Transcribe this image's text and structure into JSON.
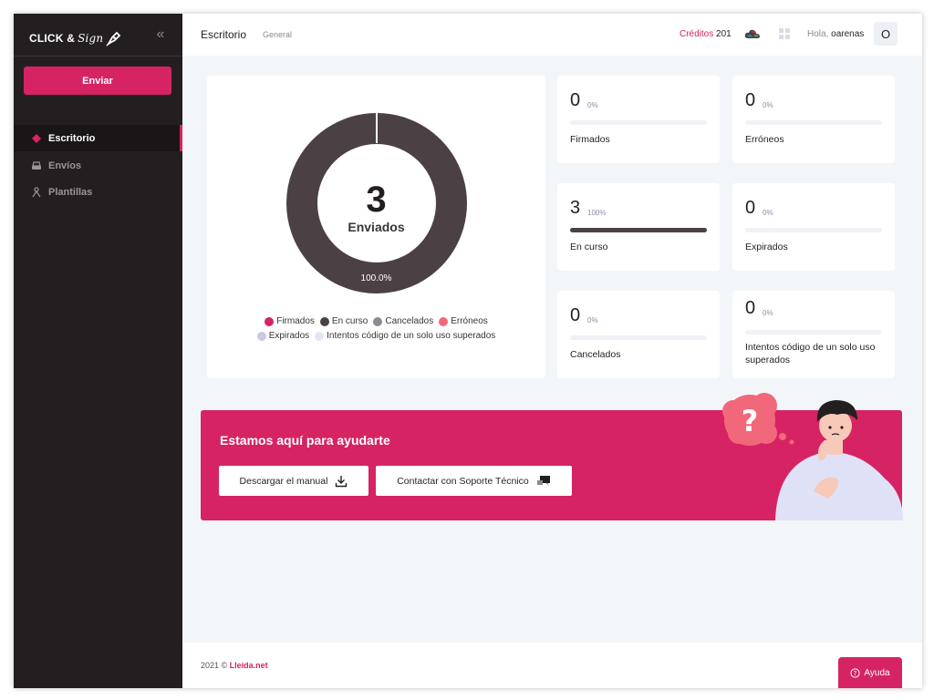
{
  "brand": {
    "name": "CLICK &",
    "script": "Sign"
  },
  "sidebar": {
    "send_label": "Enviar",
    "items": [
      {
        "label": "Escritorio",
        "icon": "diamond-icon",
        "active": true
      },
      {
        "label": "Envíos",
        "icon": "inbox-tray-icon",
        "active": false
      },
      {
        "label": "Plantillas",
        "icon": "template-person-icon",
        "active": false
      }
    ]
  },
  "topbar": {
    "title": "Escritorio",
    "crumb": "General",
    "credits_label": "Créditos",
    "credits_value": "201",
    "greeting": "Hola,",
    "username": "oarenas",
    "avatar_initial": "O"
  },
  "donut": {
    "center_value": "3",
    "center_label": "Enviados",
    "segment_label": "100.0%",
    "fraction": 1.0,
    "colors": {
      "ring": "#4b4145"
    }
  },
  "legend": [
    {
      "label": "Firmados",
      "color": "#d62364"
    },
    {
      "label": "En curso",
      "color": "#4b4145"
    },
    {
      "label": "Cancelados",
      "color": "#8e8a91"
    },
    {
      "label": "Erróneos",
      "color": "#f2687b"
    },
    {
      "label": "Expirados",
      "color": "#c9c9e3"
    },
    {
      "label": "Intentos código de un solo uso superados",
      "color": "#e4e4f4"
    }
  ],
  "stats": [
    {
      "label": "Firmados",
      "value": "0",
      "pct": "0%",
      "fraction": 0
    },
    {
      "label": "Erróneos",
      "value": "0",
      "pct": "0%",
      "fraction": 0
    },
    {
      "label": "En curso",
      "value": "3",
      "pct": "100%",
      "fraction": 1
    },
    {
      "label": "Expirados",
      "value": "0",
      "pct": "0%",
      "fraction": 0
    },
    {
      "label": "Cancelados",
      "value": "0",
      "pct": "0%",
      "fraction": 0
    },
    {
      "label": "Intentos código de un solo uso superados",
      "value": "0",
      "pct": "0%",
      "fraction": 0
    }
  ],
  "help": {
    "title": "Estamos aquí para ayudarte",
    "manual_label": "Descargar el manual",
    "support_label": "Contactar con Soporte Técnico"
  },
  "footer": {
    "copyright": "2021 ©",
    "brand": "Lleida.net",
    "help_label": "Ayuda"
  },
  "colors": {
    "accent": "#d62364",
    "sidebar": "#231f20",
    "background": "#f3f6f9"
  }
}
